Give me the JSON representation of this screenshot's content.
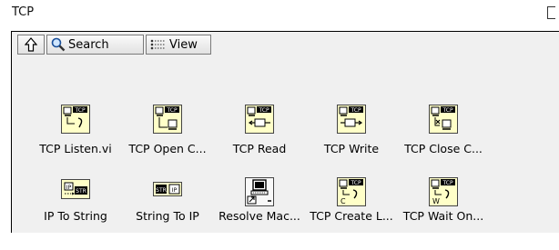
{
  "window": {
    "title": "TCP"
  },
  "toolbar": {
    "search_label": "Search",
    "view_label": "View"
  },
  "items": [
    {
      "label": "TCP Listen.vi",
      "icon": "tcp-listen-icon"
    },
    {
      "label": "TCP Open C...",
      "icon": "tcp-open-icon"
    },
    {
      "label": "TCP Read",
      "icon": "tcp-read-icon"
    },
    {
      "label": "TCP Write",
      "icon": "tcp-write-icon"
    },
    {
      "label": "TCP Close C...",
      "icon": "tcp-close-icon"
    },
    {
      "label": "IP To String",
      "icon": "ip-to-string-icon"
    },
    {
      "label": "String To IP",
      "icon": "string-to-ip-icon"
    },
    {
      "label": "Resolve Mac...",
      "icon": "resolve-machine-icon"
    },
    {
      "label": "TCP Create L...",
      "icon": "tcp-create-listener-icon"
    },
    {
      "label": "TCP Wait On...",
      "icon": "tcp-wait-on-listener-icon"
    }
  ],
  "icon_text": {
    "tcp": "TCP",
    "ip": "IP",
    "str": "STR",
    "c": "C",
    "w": "W"
  },
  "colors": {
    "icon_fill": "#ffffc8",
    "icon_border": "#444444",
    "panel_bg": "#f0f0f0"
  }
}
